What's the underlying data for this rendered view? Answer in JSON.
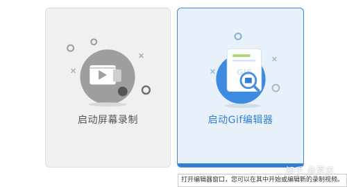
{
  "cards": [
    {
      "label": "启动屏幕录制",
      "icon": "video-camera-icon",
      "selected": false
    },
    {
      "label": "启动Gif编辑器",
      "icon": "gif-document-icon",
      "selected": true
    }
  ],
  "tooltip": {
    "text": "打开编辑器窗口，您可以在其中开始或编辑新的录制视频。"
  },
  "watermark": {
    "text": "知乎 @夏末"
  },
  "colors": {
    "accent": "#2f7fd3",
    "card_bg": "#f0f0f0",
    "selected_bg": "#e8f0f9"
  }
}
